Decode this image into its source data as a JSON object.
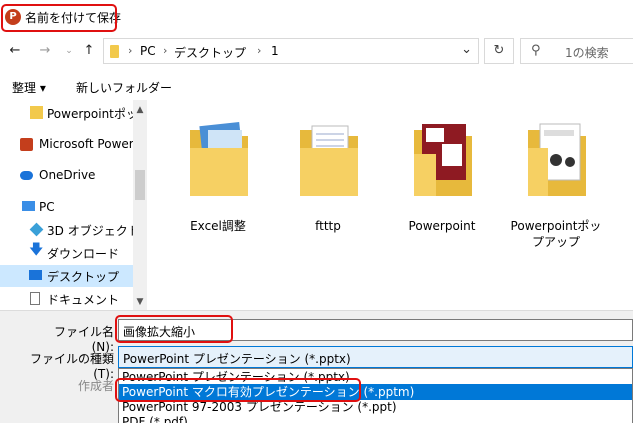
{
  "window": {
    "title": "名前を付けて保存",
    "app_icon_letter": "P"
  },
  "addressbar": {
    "crumbs": [
      "PC",
      "デスクトップ",
      "1"
    ],
    "separator": "›",
    "search_placeholder": "1の検索"
  },
  "toolbar": {
    "organize_label": "整理 ▾",
    "new_folder_label": "新しいフォルダー"
  },
  "sidebar": {
    "items": [
      {
        "label": "Powerpointポップ",
        "icon": "folder-icon"
      },
      {
        "label": "Microsoft PowerPo",
        "icon": "powerpoint-icon"
      },
      {
        "label": "OneDrive",
        "icon": "cloud-icon"
      },
      {
        "label": "PC",
        "icon": "computer-icon"
      },
      {
        "label": "3D オブジェクト",
        "icon": "cube-icon"
      },
      {
        "label": "ダウンロード",
        "icon": "download-icon"
      },
      {
        "label": "デスクトップ",
        "icon": "desktop-icon"
      },
      {
        "label": "ドキュメント",
        "icon": "document-icon"
      }
    ]
  },
  "files": [
    {
      "label": "Excel調整"
    },
    {
      "label": "ftttp"
    },
    {
      "label": "Powerpoint"
    },
    {
      "label": "Powerpointポップアップ"
    }
  ],
  "form": {
    "filename_label": "ファイル名(N):",
    "filename_value": "画像拡大縮小",
    "filetype_label": "ファイルの種類(T):",
    "filetype_value": "PowerPoint プレゼンテーション (*.pptx)",
    "author_label": "作成者",
    "filetype_options": [
      "PowerPoint プレゼンテーション (*.pptx)",
      "PowerPoint マクロ有効プレゼンテーション (*.pptm)",
      "PowerPoint 97-2003 プレゼンテーション (*.ppt)",
      "PDF (*.pdf)"
    ]
  },
  "colors": {
    "highlight_red": "#e01010",
    "selection_blue": "#0078d7",
    "sidebar_selected": "#cce8ff",
    "folder_yellow": "#f2c94c"
  }
}
